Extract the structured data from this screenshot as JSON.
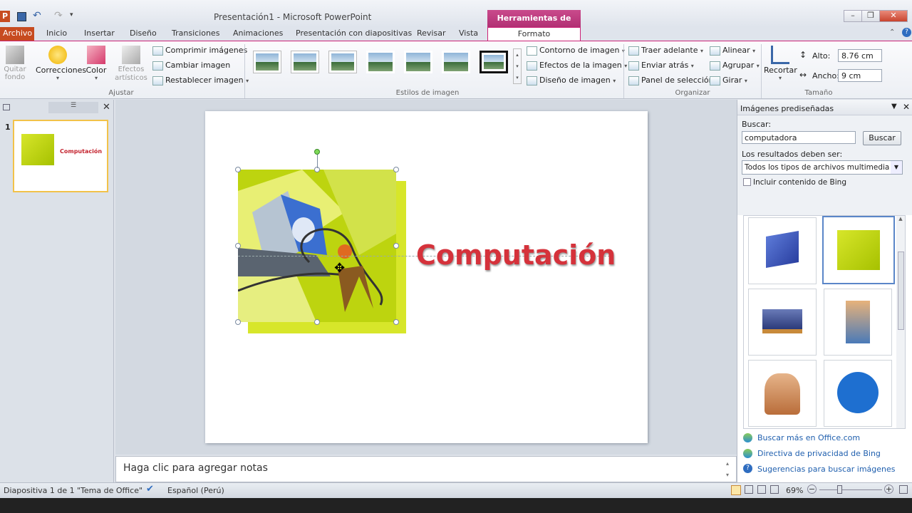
{
  "window": {
    "title": "Presentación1 - Microsoft PowerPoint",
    "context_tab_group": "Herramientas de imagen"
  },
  "tabs": [
    "Archivo",
    "Inicio",
    "Insertar",
    "Diseño",
    "Transiciones",
    "Animaciones",
    "Presentación con diapositivas",
    "Revisar",
    "Vista",
    "Formato"
  ],
  "ribbon": {
    "ajustar": {
      "label": "Ajustar",
      "quitar_fondo": "Quitar fondo",
      "correcciones": "Correcciones",
      "color": "Color",
      "efectos_artisticos": "Efectos artísticos",
      "comprimir": "Comprimir imágenes",
      "cambiar": "Cambiar imagen",
      "restablecer": "Restablecer imagen"
    },
    "estilos": {
      "label": "Estilos de imagen",
      "contorno": "Contorno de imagen",
      "efectos": "Efectos de la imagen",
      "diseno": "Diseño de imagen"
    },
    "organizar": {
      "label": "Organizar",
      "traer": "Traer adelante",
      "enviar": "Enviar atrás",
      "panel": "Panel de selección",
      "alinear": "Alinear",
      "agrupar": "Agrupar",
      "girar": "Girar"
    },
    "tamano": {
      "label": "Tamaño",
      "recortar": "Recortar",
      "alto_label": "Alto:",
      "alto_value": "8.76 cm",
      "ancho_label": "Ancho:",
      "ancho_value": "9 cm"
    }
  },
  "slides_pane": {
    "slide_number": "1",
    "thumb_text": "Computación"
  },
  "slide": {
    "title_text": "Computación"
  },
  "notes": {
    "placeholder": "Haga clic para agregar notas"
  },
  "clip_pane": {
    "title": "Imágenes prediseñadas",
    "search_label": "Buscar:",
    "search_value": "computadora",
    "search_button": "Buscar",
    "results_label": "Los resultados deben ser:",
    "results_select": "Todos los tipos de archivos multimedia",
    "bing_checkbox": "Incluir contenido de Bing",
    "links": [
      "Buscar más en Office.com",
      "Directiva de privacidad de Bing",
      "Sugerencias para buscar imágenes"
    ]
  },
  "status": {
    "slide_info": "Diapositiva 1 de 1",
    "theme": "\"Tema de Office\"",
    "language": "Español (Perú)",
    "zoom": "69%"
  }
}
